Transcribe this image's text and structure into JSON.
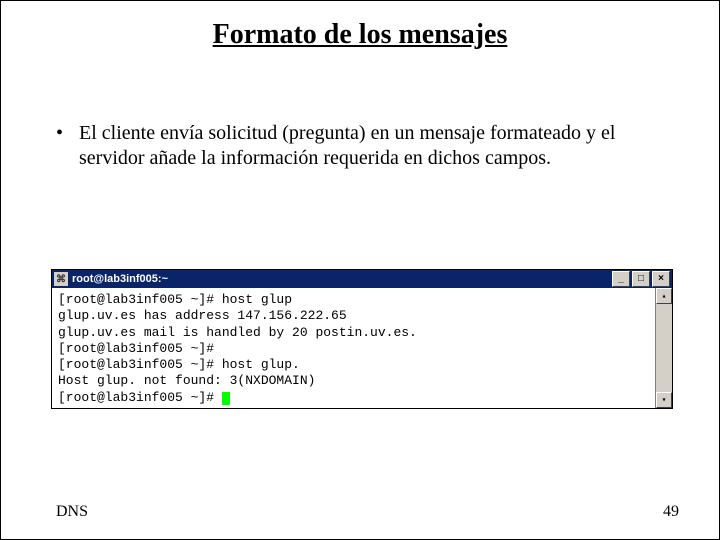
{
  "title": "Formato de los mensajes",
  "bullet": "El cliente envía solicitud (pregunta) en un mensaje formateado y el servidor añade la información requerida en dichos campos.",
  "terminal": {
    "title": "root@lab3inf005:~",
    "lines": [
      "[root@lab3inf005 ~]# host glup",
      "glup.uv.es has address 147.156.222.65",
      "glup.uv.es mail is handled by 20 postin.uv.es.",
      "[root@lab3inf005 ~]#",
      "[root@lab3inf005 ~]# host glup.",
      "Host glup. not found: 3(NXDOMAIN)",
      "[root@lab3inf005 ~]# "
    ]
  },
  "footer": {
    "left": "DNS",
    "right": "49"
  },
  "buttons": {
    "min": "_",
    "max": "□",
    "close": "×",
    "up": "▴",
    "down": "▾"
  }
}
